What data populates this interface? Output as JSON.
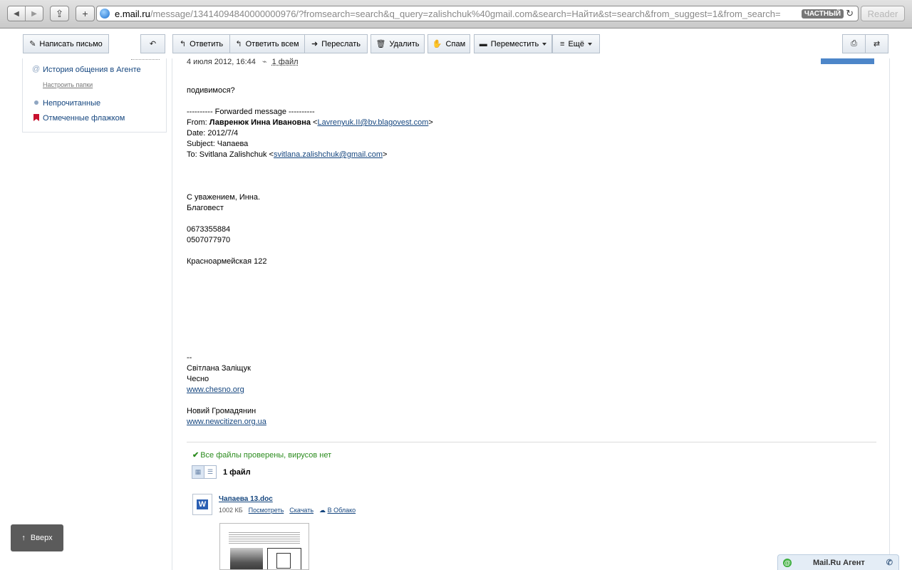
{
  "browser": {
    "url_host": "e.mail.ru",
    "url_rest": "/message/13414094840000000976/?fromsearch=search&q_query=zalishchuk%40gmail.com&search=Найти&st=search&from_suggest=1&from_search=",
    "private_badge": "ЧАСТНЫЙ",
    "reader_label": "Reader"
  },
  "toolbar": {
    "compose": "Написать письмо",
    "reply": "Ответить",
    "reply_all": "Ответить всем",
    "forward": "Переслать",
    "delete": "Удалить",
    "spam": "Спам",
    "move": "Переместить",
    "more": "Ещё"
  },
  "sidebar": {
    "agent_history": "История общения в Агенте",
    "configure_folders": "Настроить папки",
    "unread": "Непрочитанные",
    "flagged": "Отмеченные флажком"
  },
  "message": {
    "date": "4 июля 2012, 16:44",
    "attachment_link": "1 файл",
    "intro": "подивимося?",
    "fwd_header": "---------- Forwarded message ----------",
    "from_prefix": "From: ",
    "from_name": "Лавренюк Инна Ивановна",
    "from_email": "Lavrenyuk.II@bv.blagovest.com",
    "date_line": "Date: 2012/7/4",
    "subject_line": "Subject: Чапаева",
    "to_prefix": "To: Svitlana Zalishchuk <",
    "to_email": "svitlana.zalishchuk@gmail.com",
    "regards": "С уважением, Инна.",
    "company": "Благовест",
    "phone1": "0673355884",
    "phone2": "0507077970",
    "address": "Красноармейская 122",
    "sig_dash": "--",
    "sig_name": "Світлана Заліщук",
    "sig_org": "Чесно",
    "sig_link1": "www.chesno.org",
    "sig_org2": "Новий Громадянин",
    "sig_link2": "www.newcitizen.org.ua"
  },
  "attachments": {
    "virus_status": "Все файлы проверены, вирусов нет",
    "count": "1 файл",
    "file_name": "Чапаева 13.doc",
    "file_size": "1002 КБ",
    "view": "Посмотреть",
    "download": "Скачать",
    "cloud": "В Облако",
    "doc_badge": "W"
  },
  "overlay": {
    "up": "Вверх",
    "agent": "Mail.Ru Агент"
  }
}
